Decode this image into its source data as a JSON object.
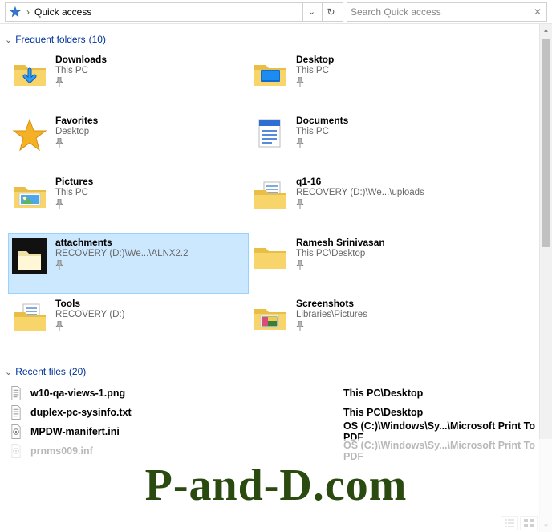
{
  "toolbar": {
    "breadcrumb_root_glyph": "star",
    "breadcrumb_text": "Quick access",
    "dropdown_chevron": "⌄",
    "refresh_label": "⟳",
    "search_placeholder": "Search Quick access"
  },
  "groups": {
    "frequent": {
      "header": "Frequent folders",
      "count": "(10)",
      "chevron": "⌄"
    },
    "recent": {
      "header": "Recent files",
      "count": "(20)",
      "chevron": "⌄"
    }
  },
  "folders": [
    {
      "name": "Downloads",
      "path": "This PC",
      "icon": "downloads",
      "selected": false
    },
    {
      "name": "Desktop",
      "path": "This PC",
      "icon": "desktop",
      "selected": false
    },
    {
      "name": "Favorites",
      "path": "Desktop",
      "icon": "favorites",
      "selected": false
    },
    {
      "name": "Documents",
      "path": "This PC",
      "icon": "documents",
      "selected": false
    },
    {
      "name": "Pictures",
      "path": "This PC",
      "icon": "pictures",
      "selected": false
    },
    {
      "name": "q1-16",
      "path": "RECOVERY (D:)\\We...\\uploads",
      "icon": "folder-docs",
      "selected": false
    },
    {
      "name": "attachments",
      "path": "RECOVERY (D:)\\We...\\ALNX2.2",
      "icon": "attachments",
      "selected": true
    },
    {
      "name": "Ramesh Srinivasan",
      "path": "This PC\\Desktop",
      "icon": "folder",
      "selected": false
    },
    {
      "name": "Tools",
      "path": "RECOVERY (D:)",
      "icon": "folder-docs",
      "selected": false
    },
    {
      "name": "Screenshots",
      "path": "Libraries\\Pictures",
      "icon": "screenshots",
      "selected": false
    }
  ],
  "pin_glyph": "📌",
  "recent": [
    {
      "name": "w10-qa-views-1.png",
      "loc": "This PC\\Desktop",
      "icon": "png"
    },
    {
      "name": "duplex-pc-sysinfo.txt",
      "loc": "This PC\\Desktop",
      "icon": "txt"
    },
    {
      "name": "MPDW-manifert.ini",
      "loc": "OS (C:)\\Windows\\Sy...\\Microsoft Print To PDF",
      "icon": "ini"
    },
    {
      "name": "prnms009.inf",
      "loc": "OS (C:)\\Windows\\Sy...\\Microsoft Print To PDF",
      "icon": "inf"
    }
  ],
  "watermark": "P-and-D.com"
}
